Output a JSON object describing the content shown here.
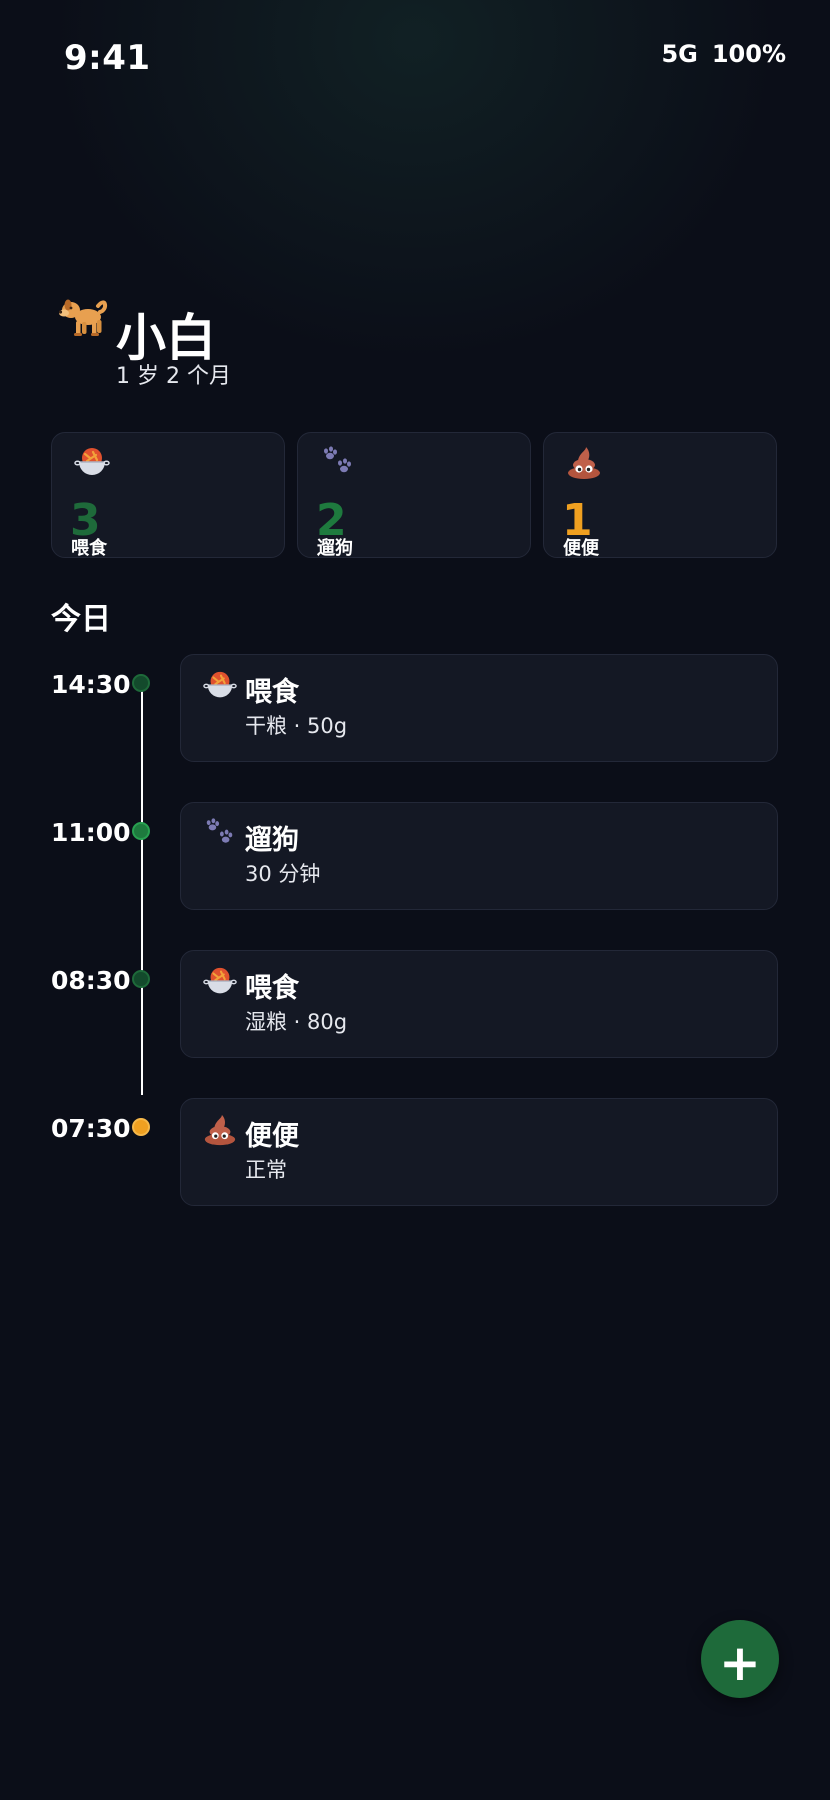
{
  "status_bar": {
    "time": "9:41",
    "network": "5G",
    "battery": "100%"
  },
  "pet": {
    "avatar_icon": "dog-icon",
    "name": "小白",
    "age": "1 岁 2 个月"
  },
  "stats": [
    {
      "icon": "food-bowl-icon",
      "value": "3",
      "label": "喂食",
      "color": "#1e6a3a"
    },
    {
      "icon": "paw-icon",
      "value": "2",
      "label": "遛狗",
      "color": "#1e7a3e"
    },
    {
      "icon": "poop-icon",
      "value": "1",
      "label": "便便",
      "color": "#f0a020"
    }
  ],
  "today": {
    "title": "今日",
    "entries": [
      {
        "time": "14:30",
        "icon": "food-bowl-icon",
        "title": "喂食",
        "detail": "干粮 · 50g",
        "dot_color": "#134a2c",
        "dot_border": "#1e6a3a"
      },
      {
        "time": "11:00",
        "icon": "paw-icon",
        "title": "遛狗",
        "detail": "30 分钟",
        "dot_color": "#1e7a3e",
        "dot_border": "#28a050"
      },
      {
        "time": "08:30",
        "icon": "food-bowl-icon",
        "title": "喂食",
        "detail": "湿粮 · 80g",
        "dot_color": "#134a2c",
        "dot_border": "#1e6a3a"
      },
      {
        "time": "07:30",
        "icon": "poop-icon",
        "title": "便便",
        "detail": "正常",
        "dot_color": "#f0a020",
        "dot_border": "#f6b84a"
      }
    ]
  },
  "fab": {
    "icon": "plus-icon",
    "symbol": "+"
  },
  "colors": {
    "background": "#0b0e18",
    "card": "#141824",
    "card_border": "#232838",
    "accent_green": "#1e6a3a",
    "accent_orange": "#f0a020"
  }
}
